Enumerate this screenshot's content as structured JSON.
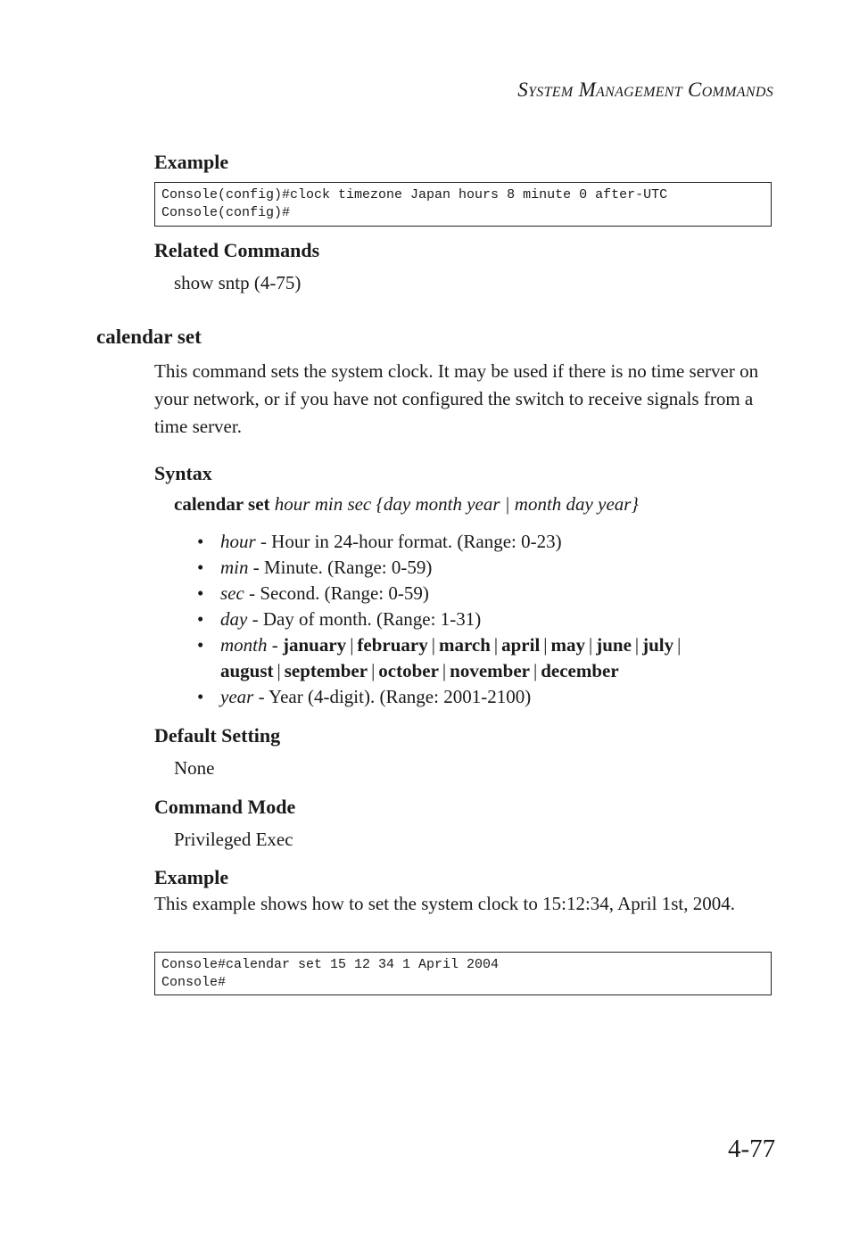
{
  "header": {
    "running_title_parts": [
      {
        "cap": "S",
        "rest": "YSTEM"
      },
      {
        "cap": "M",
        "rest": "ANAGEMENT"
      },
      {
        "cap": "C",
        "rest": "OMMANDS"
      }
    ]
  },
  "prev_section": {
    "example_heading": "Example",
    "code_lines": [
      "Console(config)#clock timezone Japan hours 8 minute 0 after-UTC",
      "Console(config)#"
    ],
    "related_heading": "Related Commands",
    "related_text": "show sntp (4-75)"
  },
  "section": {
    "title": "calendar set",
    "description": "This command sets the system clock. It may be used if there is no time server on your network, or if you have not configured the switch to receive signals from a time server.",
    "syntax_heading": "Syntax",
    "syntax": {
      "command": "calendar set",
      "args": "hour min sec {day month year | month day year}"
    },
    "params": [
      {
        "name": "hour",
        "desc": " - Hour in 24-hour format. (Range: 0-23)"
      },
      {
        "name": "min",
        "desc": " - Minute. (Range: 0-59)"
      },
      {
        "name": "sec",
        "desc": " - Second. (Range: 0-59)"
      },
      {
        "name": "day",
        "desc": " - Day of month. (Range: 1-31)"
      },
      {
        "name": "month",
        "desc": " - ",
        "options": [
          "january",
          "february",
          "march",
          "april",
          "may",
          "june",
          "july",
          "august",
          "september",
          "october",
          "november",
          "december"
        ]
      },
      {
        "name": "year",
        "desc": " - Year (4-digit). (Range: 2001-2100)"
      }
    ],
    "default_heading": "Default Setting",
    "default_value": "None",
    "mode_heading": "Command Mode",
    "mode_value": "Privileged Exec",
    "example_heading": "Example",
    "example_text": "This example shows how to set the system clock to 15:12:34, April 1st, 2004.",
    "code_lines": [
      "Console#calendar set 15 12 34 1 April 2004",
      "Console#"
    ]
  },
  "footer": {
    "page_number": "4-77"
  }
}
